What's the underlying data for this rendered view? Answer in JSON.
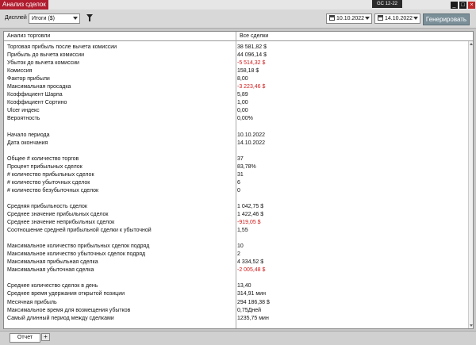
{
  "window": {
    "title": "Анализ сделок",
    "instrument": "GC 12-22",
    "minimize": "_",
    "maximize": "□",
    "close": "×"
  },
  "toolbar": {
    "display_label": "Дисплей",
    "display_value": "Итоги ($)",
    "date_from": "10.10.2022",
    "date_to": "14.10.2022",
    "generate_label": "Генерировать"
  },
  "table": {
    "headers": [
      "Анализ торговли",
      "Все сделки"
    ],
    "rows": [
      {
        "label": "Торговая прибыль после вычета комиссии",
        "value": "38 581,82 $"
      },
      {
        "label": "Прибыль до вычета комиссии",
        "value": "44 096,14 $"
      },
      {
        "label": "Убыток до вычета комиссии",
        "value": "-5 514,32 $",
        "negative": true
      },
      {
        "label": "Комиссия",
        "value": "158,18 $"
      },
      {
        "label": "Фактор прибыли",
        "value": "8,00"
      },
      {
        "label": "Максимальная просадка",
        "value": "-3 223,46 $",
        "negative": true
      },
      {
        "label": "Коэффициент Шарпа",
        "value": "5,89"
      },
      {
        "label": "Коэффициент Сортино",
        "value": "1,00"
      },
      {
        "label": "Ulcer индекс",
        "value": "0,00"
      },
      {
        "label": "Вероятность",
        "value": "0,00%"
      },
      {
        "label": "",
        "value": ""
      },
      {
        "label": "Начало периода",
        "value": "10.10.2022"
      },
      {
        "label": "Дата окончания",
        "value": "14.10.2022"
      },
      {
        "label": "",
        "value": ""
      },
      {
        "label": "Общее # количество торгов",
        "value": "37"
      },
      {
        "label": "Процент прибыльных сделок",
        "value": "83,78%"
      },
      {
        "label": "# количество прибыльных сделок",
        "value": "31"
      },
      {
        "label": "# количество убыточных сделок",
        "value": "6"
      },
      {
        "label": "# количество безубыточных сделок",
        "value": "0"
      },
      {
        "label": "",
        "value": ""
      },
      {
        "label": "Средняя прибыльность сделок",
        "value": "1 042,75 $"
      },
      {
        "label": "Среднее значение прибыльных сделок",
        "value": "1 422,46 $"
      },
      {
        "label": "Среднее значение неприбыльных сделок",
        "value": "-919,05 $",
        "negative": true
      },
      {
        "label": "Соотношение средней прибыльной сделки к убыточной",
        "value": "1,55"
      },
      {
        "label": "",
        "value": ""
      },
      {
        "label": "Максимальное количество прибыльных сделок подряд",
        "value": "10"
      },
      {
        "label": "Максимальное количество убыточных сделок подряд",
        "value": "2"
      },
      {
        "label": "Максимальная прибыльная сделка",
        "value": "4 334,52 $"
      },
      {
        "label": "Максимальная убыточная сделка",
        "value": "-2 005,48 $",
        "negative": true
      },
      {
        "label": "",
        "value": ""
      },
      {
        "label": "Среднее количество сделок в день",
        "value": "13,40"
      },
      {
        "label": "Среднее время удержания открытой позиции",
        "value": "314,91 мин"
      },
      {
        "label": "Месячная прибыль",
        "value": "294 186,38 $"
      },
      {
        "label": "Максимальное время для возмещения убытков",
        "value": "0,75Дней"
      },
      {
        "label": "Самый длинный период между сделками",
        "value": "1235,75 мин"
      }
    ]
  },
  "bottom": {
    "tab_label": "Отчет",
    "add_label": "+"
  },
  "colors": {
    "title_tab": "#b01c2e",
    "negative": "#d01818",
    "generate_button": "#7b8f99"
  }
}
